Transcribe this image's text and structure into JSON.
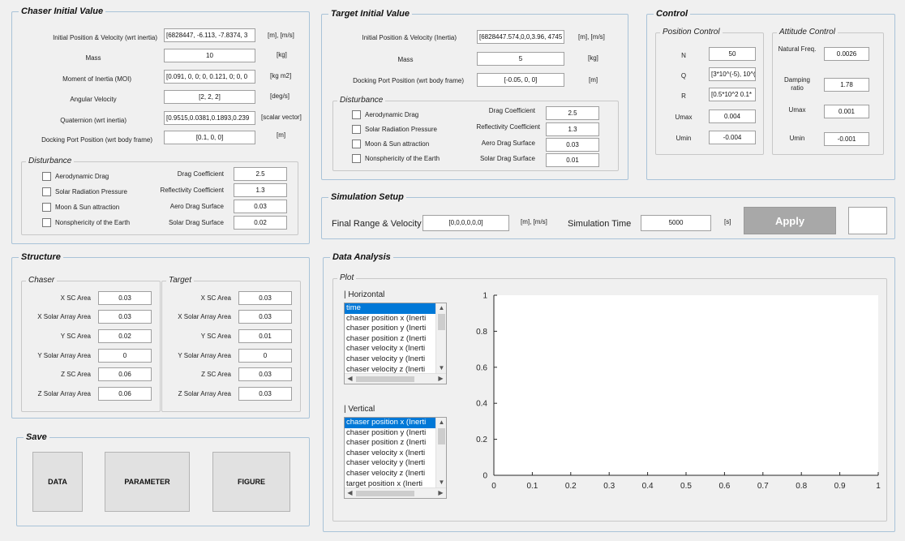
{
  "chaser": {
    "title": "Chaser Initial Value",
    "rows": [
      {
        "label": "Initial Position & Velocity (wrt inertia)",
        "value": "[6828447, -6.113, -7.8374, 3",
        "unit": "[m], [m/s]"
      },
      {
        "label": "Mass",
        "value": "10",
        "unit": "[kg]"
      },
      {
        "label": "Moment of Inertia (MOI)",
        "value": "[0.091, 0, 0; 0, 0.121, 0; 0, 0",
        "unit": "[kg m2]"
      },
      {
        "label": "Angular Velocity",
        "value": "[2, 2, 2]",
        "unit": "[deg/s]"
      },
      {
        "label": "Quaternion (wrt inertia)",
        "value": "[0.9515,0.0381,0.1893,0.239",
        "unit": "[scalar vector]"
      },
      {
        "label": "Docking Port Position (wrt body frame)",
        "value": "[0.1, 0, 0]",
        "unit": "[m]"
      }
    ],
    "disturbance": {
      "title": "Disturbance",
      "checks": [
        "Aerodynamic Drag",
        "Solar Radiation Pressure",
        "Moon & Sun attraction",
        "Nonsphericity of the Earth"
      ],
      "params": [
        {
          "label": "Drag Coefficient",
          "value": "2.5"
        },
        {
          "label": "Reflectivity Coefficient",
          "value": "1.3"
        },
        {
          "label": "Aero Drag Surface",
          "value": "0.03"
        },
        {
          "label": "Solar Drag Surface",
          "value": "0.02"
        }
      ]
    }
  },
  "target": {
    "title": "Target Initial Value",
    "rows": [
      {
        "label": "Initial Position & Velocity (Inertia)",
        "value": "[6828447.574,0,0,3.96, 4745",
        "unit": "[m], [m/s]"
      },
      {
        "label": "Mass",
        "value": "5",
        "unit": "[kg]"
      },
      {
        "label": "Docking Port Position (wrt body frame)",
        "value": "[-0.05, 0, 0]",
        "unit": "[m]"
      }
    ],
    "disturbance": {
      "title": "Disturbance",
      "checks": [
        "Aerodynamic Drag",
        "Solar Radiation Pressure",
        "Moon & Sun attraction",
        "Nonsphericity of the Earth"
      ],
      "params": [
        {
          "label": "Drag Coefficient",
          "value": "2.5"
        },
        {
          "label": "Reflectivity Coefficient",
          "value": "1.3"
        },
        {
          "label": "Aero Drag Surface",
          "value": "0.03"
        },
        {
          "label": "Solar Drag Surface",
          "value": "0.01"
        }
      ]
    }
  },
  "control": {
    "title": "Control",
    "position": {
      "title": "Position Control",
      "rows": [
        {
          "label": "N",
          "value": "50"
        },
        {
          "label": "Q",
          "value": "[3*10^(-5), 10^("
        },
        {
          "label": "R",
          "value": "[0.5*10^2 0.1*"
        },
        {
          "label": "Umax",
          "value": "0.004"
        },
        {
          "label": "Umin",
          "value": "-0.004"
        }
      ]
    },
    "attitude": {
      "title": "Attitude Control",
      "rows": [
        {
          "label": "Natural Freq.",
          "value": "0.0026"
        },
        {
          "label": "Damping ratio",
          "value": "1.78"
        },
        {
          "label": "Umax",
          "value": "0.001"
        },
        {
          "label": "Umin",
          "value": "-0.001"
        }
      ]
    }
  },
  "simulation": {
    "title": "Simulation Setup",
    "final_label": "Final Range & Velocity",
    "final_value": "[0,0,0,0,0,0]",
    "final_unit": "[m], [m/s]",
    "time_label": "Simulation Time",
    "time_value": "5000",
    "time_unit": "[s]",
    "apply_label": "Apply",
    "status_value": ""
  },
  "structure": {
    "title": "Structure",
    "chaser": {
      "title": "Chaser",
      "rows": [
        {
          "label": "X SC Area",
          "value": "0.03"
        },
        {
          "label": "X Solar Array Area",
          "value": "0.03"
        },
        {
          "label": "Y SC Area",
          "value": "0.02"
        },
        {
          "label": "Y Solar Array Area",
          "value": "0"
        },
        {
          "label": "Z SC Area",
          "value": "0.06"
        },
        {
          "label": "Z Solar Array Area",
          "value": "0.06"
        }
      ]
    },
    "target": {
      "title": "Target",
      "rows": [
        {
          "label": "X SC Area",
          "value": "0.03"
        },
        {
          "label": "X Solar Array Area",
          "value": "0.03"
        },
        {
          "label": "Y SC Area",
          "value": "0.01"
        },
        {
          "label": "Y Solar Array Area",
          "value": "0"
        },
        {
          "label": "Z SC Area",
          "value": "0.03"
        },
        {
          "label": "Z Solar Array Area",
          "value": "0.03"
        }
      ]
    }
  },
  "save": {
    "title": "Save",
    "buttons": [
      "DATA",
      "PARAMETER",
      "FIGURE"
    ]
  },
  "analysis": {
    "title": "Data Analysis",
    "plot_title": "Plot",
    "horizontal_label": "| Horizontal",
    "horizontal_items": [
      "time",
      "chaser position x (Inerti",
      "chaser position y (Inerti",
      "chaser position z (Inerti",
      "chaser velocity x (Inerti",
      "chaser velocity y (Inerti",
      "chaser velocity z (Inerti"
    ],
    "vertical_label": "| Vertical",
    "vertical_items": [
      "chaser position x (Inerti",
      "chaser position y (Inerti",
      "chaser position z (Inerti",
      "chaser velocity x (Inerti",
      "chaser velocity y (Inerti",
      "chaser velocity z (Inerti",
      "target position x (Inerti"
    ]
  },
  "chart_data": {
    "type": "line",
    "series": [],
    "xlim": [
      0,
      1
    ],
    "ylim": [
      0,
      1
    ],
    "xticks": [
      "0",
      "0.1",
      "0.2",
      "0.3",
      "0.4",
      "0.5",
      "0.6",
      "0.7",
      "0.8",
      "0.9",
      "1"
    ],
    "yticks": [
      "0",
      "0.2",
      "0.4",
      "0.6",
      "0.8",
      "1"
    ],
    "grid": false
  }
}
